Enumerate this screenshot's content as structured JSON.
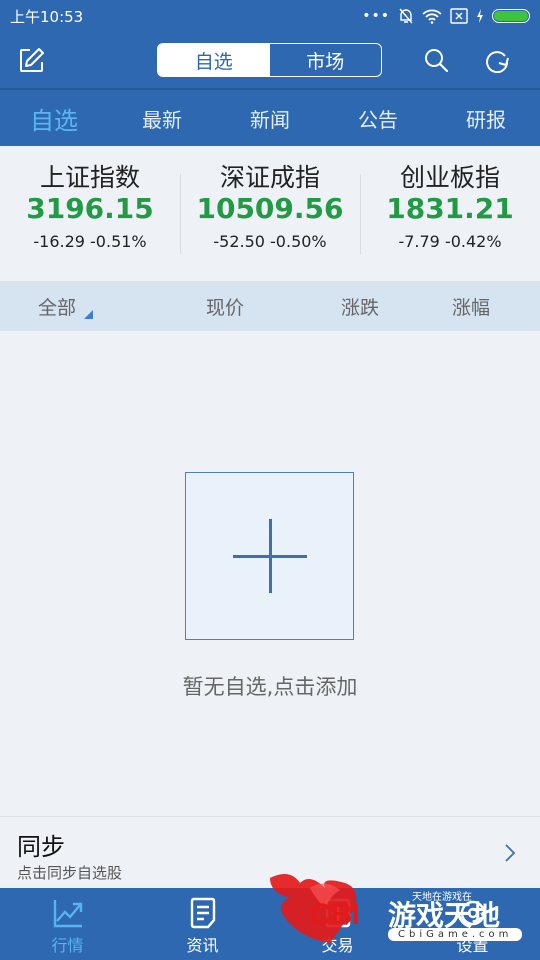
{
  "status_bar": {
    "time": "上午10:53",
    "icons": [
      "more-dots-icon",
      "bell-muted-icon",
      "wifi-icon",
      "sim-none-icon",
      "charging-icon",
      "battery-icon"
    ]
  },
  "top_bar": {
    "edit_icon": "edit-icon",
    "segments": [
      {
        "label": "自选",
        "active": true
      },
      {
        "label": "市场",
        "active": false
      }
    ],
    "search_icon": "search-icon",
    "refresh_icon": "refresh-icon"
  },
  "nav_tabs": [
    {
      "label": "自选",
      "active": true
    },
    {
      "label": "最新",
      "active": false
    },
    {
      "label": "新闻",
      "active": false
    },
    {
      "label": "公告",
      "active": false
    },
    {
      "label": "研报",
      "active": false
    }
  ],
  "indices": [
    {
      "name": "上证指数",
      "price": "3196.15",
      "change": "-16.29 -0.51%"
    },
    {
      "name": "深证成指",
      "price": "10509.56",
      "change": "-52.50 -0.50%"
    },
    {
      "name": "创业板指",
      "price": "1831.21",
      "change": "-7.79 -0.42%"
    }
  ],
  "columns": {
    "all": "全部",
    "price": "现价",
    "change": "涨跌",
    "change_pct": "涨幅"
  },
  "empty_state": {
    "message": "暂无自选,点击添加"
  },
  "sync": {
    "title": "同步",
    "subtitle": "点击同步自选股"
  },
  "bottom_tabs": [
    {
      "label": "行情",
      "icon": "chart-trend-icon",
      "active": true
    },
    {
      "label": "资讯",
      "icon": "document-icon",
      "active": false
    },
    {
      "label": "交易",
      "icon": "trade-icon",
      "active": false
    },
    {
      "label": "设置",
      "icon": "settings-icon",
      "active": false
    }
  ],
  "watermark": {
    "brand": "CBI",
    "name": "游戏天地",
    "tagline": "天地在游戏在",
    "url": "CbiGame.com"
  },
  "colors": {
    "brand_blue": "#2d68b0",
    "active_tab": "#5ab6f0",
    "price_green": "#229944",
    "header_bg": "#d6e4f2"
  }
}
